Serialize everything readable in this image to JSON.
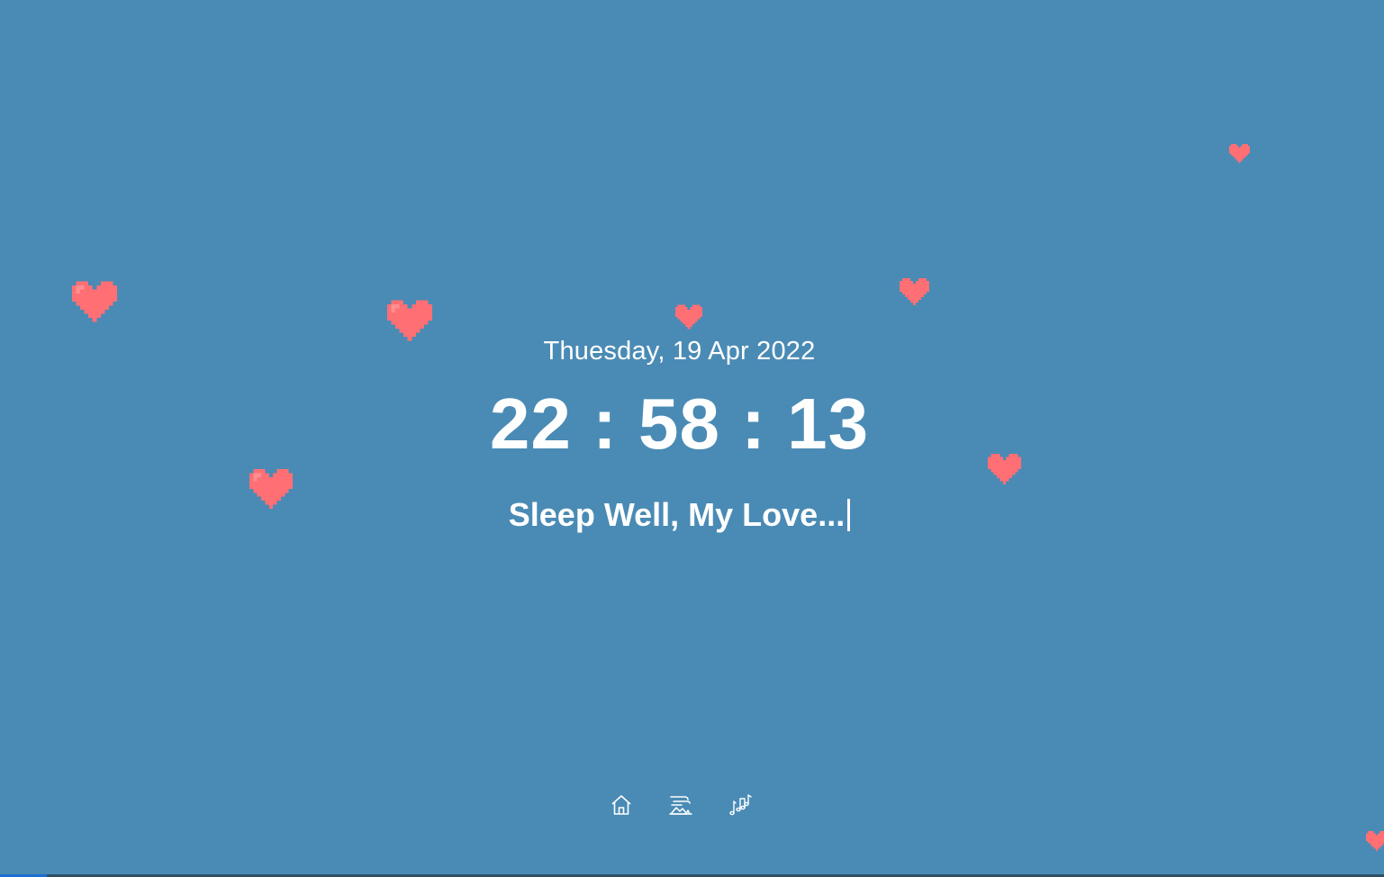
{
  "clock": {
    "date": "Thuesday, 19 Apr 2022",
    "time": "22 : 58 : 13",
    "message": "Sleep Well, My Love..."
  },
  "nav": {
    "items": [
      {
        "icon": "home-icon"
      },
      {
        "icon": "landscape-icon"
      },
      {
        "icon": "music-notes-icon"
      }
    ]
  },
  "colors": {
    "background": "#4a8bb5",
    "heart": "#ff6f73",
    "text": "#ffffff"
  }
}
